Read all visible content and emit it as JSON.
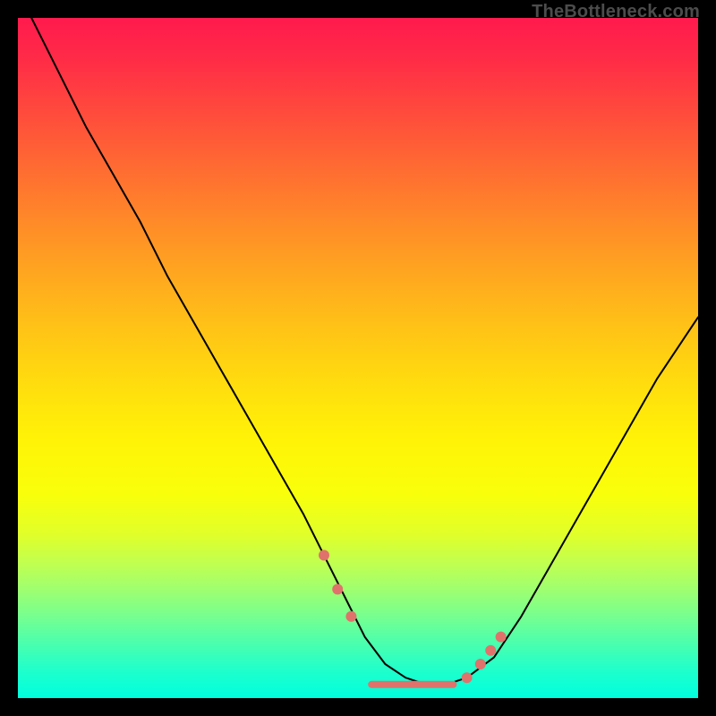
{
  "watermark": "TheBottleneck.com",
  "chart_data": {
    "type": "line",
    "title": "",
    "xlabel": "",
    "ylabel": "",
    "xlim": [
      0,
      100
    ],
    "ylim": [
      0,
      100
    ],
    "series": [
      {
        "name": "bottleneck-curve",
        "x": [
          2,
          6,
          10,
          14,
          18,
          22,
          26,
          30,
          34,
          38,
          42,
          45,
          48,
          51,
          54,
          57,
          60,
          63,
          66,
          70,
          74,
          78,
          82,
          86,
          90,
          94,
          98,
          100
        ],
        "y": [
          100,
          92,
          84,
          77,
          70,
          62,
          55,
          48,
          41,
          34,
          27,
          21,
          15,
          9,
          5,
          3,
          2,
          2,
          3,
          6,
          12,
          19,
          26,
          33,
          40,
          47,
          53,
          56
        ]
      }
    ],
    "markers": {
      "left_cluster": [
        {
          "x": 45,
          "y": 21
        },
        {
          "x": 47,
          "y": 16
        },
        {
          "x": 49,
          "y": 12
        }
      ],
      "right_cluster": [
        {
          "x": 66,
          "y": 3
        },
        {
          "x": 68,
          "y": 5
        },
        {
          "x": 69.5,
          "y": 7
        },
        {
          "x": 71,
          "y": 9
        }
      ],
      "floor_bar": {
        "x0": 52,
        "x1": 64,
        "y": 2
      }
    },
    "gradient_stops": [
      {
        "pos": 0,
        "color": "#ff1a4d"
      },
      {
        "pos": 50,
        "color": "#ffd400"
      },
      {
        "pos": 100,
        "color": "#00ffc8"
      }
    ]
  }
}
